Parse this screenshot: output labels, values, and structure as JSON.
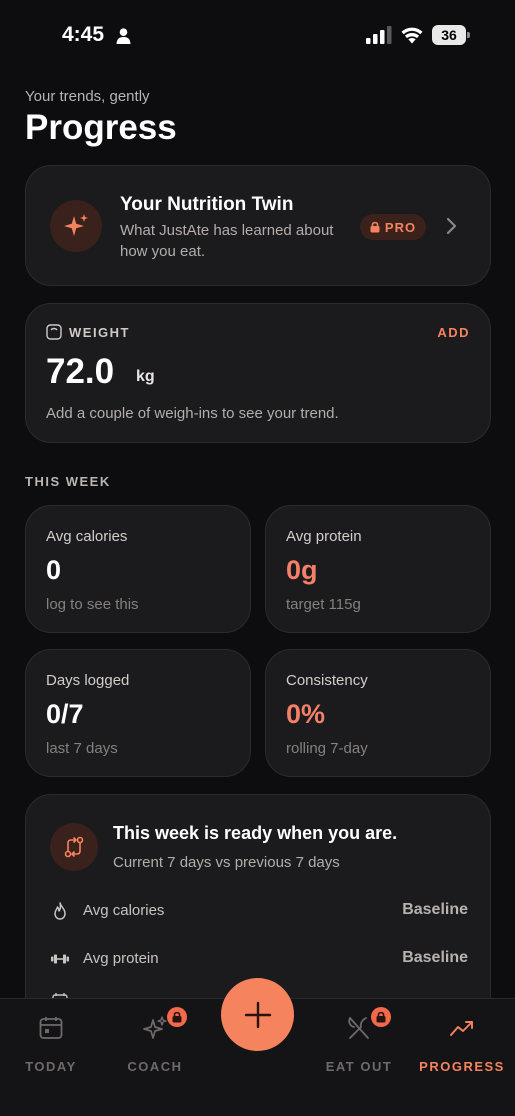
{
  "status_bar": {
    "time": "4:45",
    "battery": "36"
  },
  "header": {
    "subtitle": "Your trends, gently",
    "title": "Progress"
  },
  "twin_card": {
    "title": "Your Nutrition Twin",
    "description": "What JustAte has learned about how you eat.",
    "badge": "PRO"
  },
  "weight_card": {
    "label": "WEIGHT",
    "add_label": "ADD",
    "value": "72.0",
    "unit": "kg",
    "hint": "Add a couple of weigh-ins to see your trend."
  },
  "this_week": {
    "section_label": "THIS WEEK",
    "stats": [
      {
        "label": "Avg calories",
        "value": "0",
        "sub": "log to see this"
      },
      {
        "label": "Avg protein",
        "value": "0g",
        "sub": "target 115g"
      },
      {
        "label": "Days logged",
        "value": "0/7",
        "sub": "last 7 days"
      },
      {
        "label": "Consistency",
        "value": "0%",
        "sub": "rolling 7-day"
      }
    ]
  },
  "week_card": {
    "title": "This week is ready when you are.",
    "subtitle": "Current 7 days vs previous 7 days",
    "rows": [
      {
        "label": "Avg calories",
        "value": "Baseline"
      },
      {
        "label": "Avg protein",
        "value": "Baseline"
      }
    ]
  },
  "tabbar": {
    "tabs": [
      {
        "label": "TODAY"
      },
      {
        "label": "COACH"
      },
      {
        "label": "EAT OUT"
      },
      {
        "label": "PROGRESS"
      }
    ]
  },
  "colors": {
    "accent": "#f5835e",
    "background": "#0d0c0e",
    "card": "#1b1a1c"
  }
}
